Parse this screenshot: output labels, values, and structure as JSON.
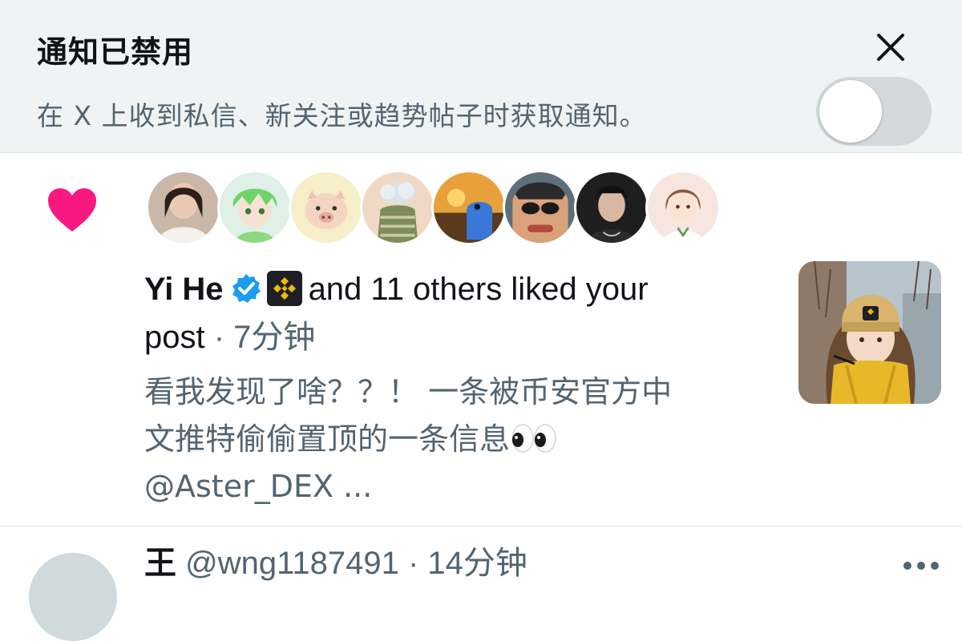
{
  "banner": {
    "title": "通知已禁用",
    "description": "在 X 上收到私信、新关注或趋势帖子时获取通知。",
    "toggle_state": "off"
  },
  "notification": {
    "type_icon": "heart-icon",
    "avatar_count": 8,
    "username": "Yi He",
    "text_part1": "and 11 others liked your",
    "text_part2": "post",
    "separator": " · ",
    "time": "7分钟",
    "preview_line1": "看我发现了啥？？！ 一条被币安官方中",
    "preview_line2": "文推特偷偷置顶的一条信息",
    "preview_line3": "@Aster_DEX ...",
    "colors": {
      "heart": "#f91880",
      "verified": "#1d9bf0",
      "org_badge_bg": "#1e2026",
      "org_badge_fg": "#f0b90b"
    }
  },
  "next_item": {
    "name": "王",
    "handle": "@wng1187491",
    "separator": " · ",
    "time": "14分钟"
  }
}
